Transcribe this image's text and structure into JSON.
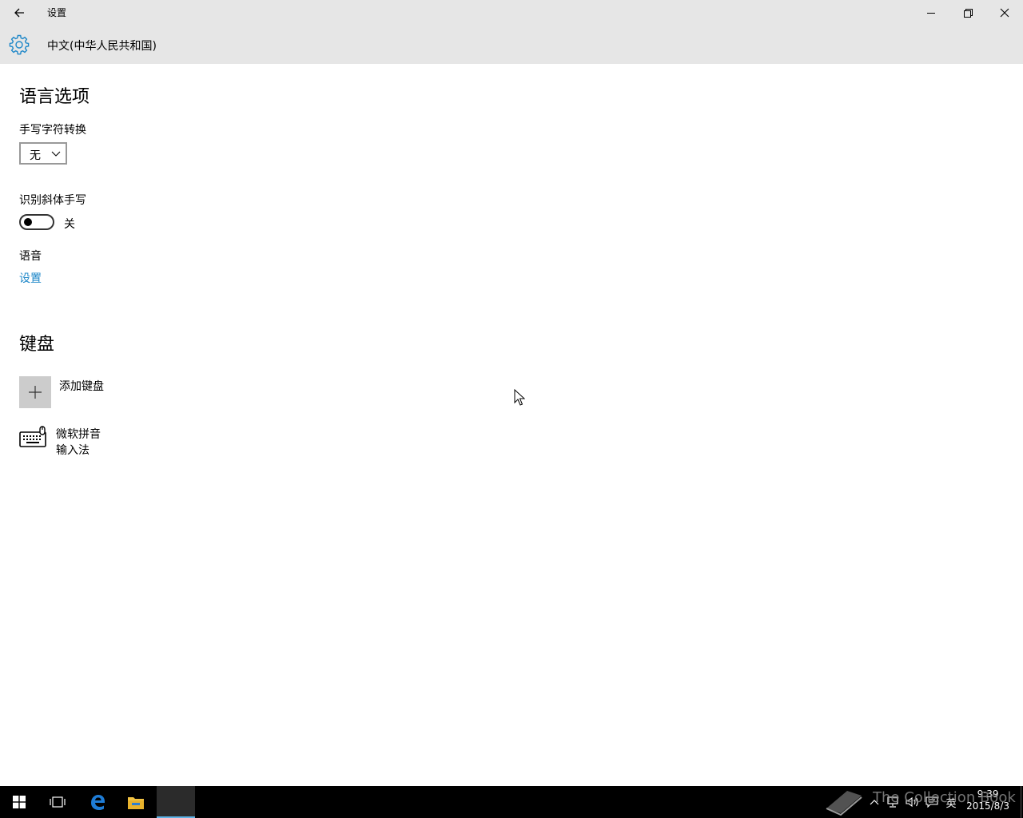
{
  "window": {
    "title": "设置",
    "minimize": "minimize",
    "restore": "restore",
    "close": "close"
  },
  "header": {
    "title": "中文(中华人民共和国)",
    "icon": "gear-icon"
  },
  "language_options": {
    "heading": "语言选项",
    "handwriting_conversion_label": "手写字符转换",
    "handwriting_conversion_value": "无",
    "italic_handwriting_label": "识别斜体手写",
    "italic_handwriting_state": "关",
    "speech_label": "语音",
    "speech_link": "设置"
  },
  "keyboard": {
    "heading": "键盘",
    "add_keyboard_label": "添加键盘",
    "items": [
      {
        "line1": "微软拼音",
        "line2": "输入法",
        "icon": "keyboard-icon"
      }
    ]
  },
  "taskbar": {
    "items": [
      "start-icon",
      "task-view-icon",
      "edge-icon",
      "file-explorer-icon",
      "settings-app"
    ],
    "tray": {
      "ime_indicator": "英",
      "time": "9:39",
      "date": "2015/8/3"
    }
  },
  "watermark": "The Collection Book",
  "colors": {
    "titlebar_bg": "#e6e6e6",
    "accent": "#1e87c8",
    "taskbar_bg": "#000000"
  }
}
